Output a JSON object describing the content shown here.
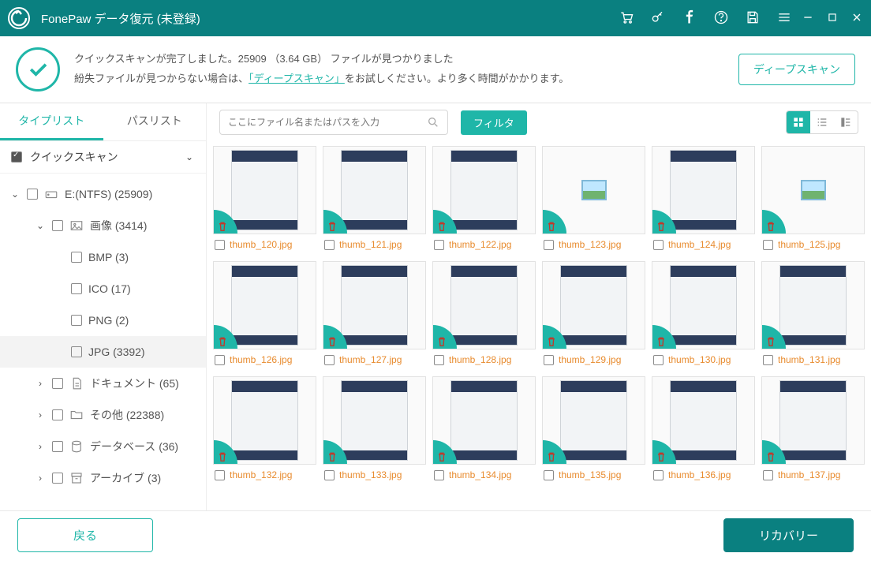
{
  "title": "FonePaw データ復元 (未登録)",
  "status": {
    "line1": "クイックスキャンが完了しました。25909 （3.64 GB） ファイルが見つかりました",
    "line2_pre": "紛失ファイルが見つからない場合は、",
    "line2_link": "「ディープスキャン」",
    "line2_post": "をお試しください。より多く時間がかかります。"
  },
  "buttons": {
    "deep_scan": "ディープスキャン",
    "back": "戻る",
    "recover": "リカバリー",
    "filter": "フィルタ"
  },
  "side_tabs": {
    "type_list": "タイプリスト",
    "path_list": "パスリスト"
  },
  "quick_scan_label": "クイックスキャン",
  "search_placeholder": "ここにファイル名またはパスを入力",
  "tree": [
    {
      "id": "drive",
      "label": "E:(NTFS) (25909)",
      "depth": 0,
      "expandable": true,
      "expanded": true,
      "icon": "drive"
    },
    {
      "id": "images",
      "label": "画像 (3414)",
      "depth": 1,
      "expandable": true,
      "expanded": true,
      "icon": "image"
    },
    {
      "id": "bmp",
      "label": "BMP (3)",
      "depth": 2,
      "expandable": false
    },
    {
      "id": "ico",
      "label": "ICO (17)",
      "depth": 2,
      "expandable": false
    },
    {
      "id": "png",
      "label": "PNG (2)",
      "depth": 2,
      "expandable": false
    },
    {
      "id": "jpg",
      "label": "JPG (3392)",
      "depth": 2,
      "expandable": false,
      "selected": true
    },
    {
      "id": "docs",
      "label": "ドキュメント (65)",
      "depth": 1,
      "expandable": true,
      "expanded": false,
      "icon": "doc"
    },
    {
      "id": "other",
      "label": "その他 (22388)",
      "depth": 1,
      "expandable": true,
      "expanded": false,
      "icon": "folder"
    },
    {
      "id": "db",
      "label": "データベース (36)",
      "depth": 1,
      "expandable": true,
      "expanded": false,
      "icon": "db"
    },
    {
      "id": "archive",
      "label": "アーカイブ (3)",
      "depth": 1,
      "expandable": true,
      "expanded": false,
      "icon": "archive"
    }
  ],
  "thumbs": [
    {
      "name": "thumb_120.jpg",
      "kind": "phone"
    },
    {
      "name": "thumb_121.jpg",
      "kind": "phone"
    },
    {
      "name": "thumb_122.jpg",
      "kind": "phone"
    },
    {
      "name": "thumb_123.jpg",
      "kind": "photo"
    },
    {
      "name": "thumb_124.jpg",
      "kind": "phone"
    },
    {
      "name": "thumb_125.jpg",
      "kind": "photo"
    },
    {
      "name": "thumb_126.jpg",
      "kind": "phone"
    },
    {
      "name": "thumb_127.jpg",
      "kind": "phone"
    },
    {
      "name": "thumb_128.jpg",
      "kind": "phone"
    },
    {
      "name": "thumb_129.jpg",
      "kind": "phone"
    },
    {
      "name": "thumb_130.jpg",
      "kind": "phone"
    },
    {
      "name": "thumb_131.jpg",
      "kind": "phone"
    },
    {
      "name": "thumb_132.jpg",
      "kind": "phone"
    },
    {
      "name": "thumb_133.jpg",
      "kind": "phone"
    },
    {
      "name": "thumb_134.jpg",
      "kind": "phone"
    },
    {
      "name": "thumb_135.jpg",
      "kind": "phone"
    },
    {
      "name": "thumb_136.jpg",
      "kind": "phone"
    },
    {
      "name": "thumb_137.jpg",
      "kind": "phone"
    }
  ]
}
